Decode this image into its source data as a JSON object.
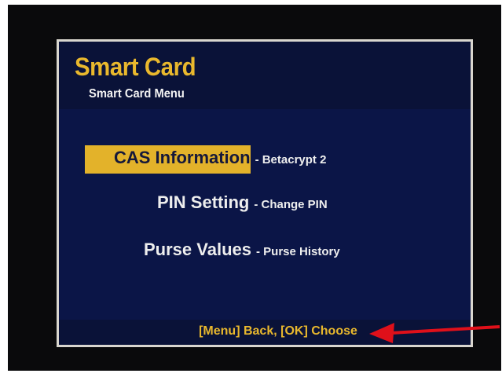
{
  "screen": {
    "title": "Smart Card",
    "subtitle": "Smart Card Menu"
  },
  "menu": {
    "items": [
      {
        "label": "CAS Information",
        "desc": "- Betacrypt 2",
        "selected": true
      },
      {
        "label": "PIN Setting",
        "desc": "- Change PIN",
        "selected": false
      },
      {
        "label": "Purse Values",
        "desc": "- Purse History",
        "selected": false
      }
    ]
  },
  "footer": {
    "hint": "[Menu] Back, [OK] Choose"
  },
  "colors": {
    "accent": "#e3b22a",
    "panel": "#0b1547",
    "arrow": "#e0101a"
  }
}
